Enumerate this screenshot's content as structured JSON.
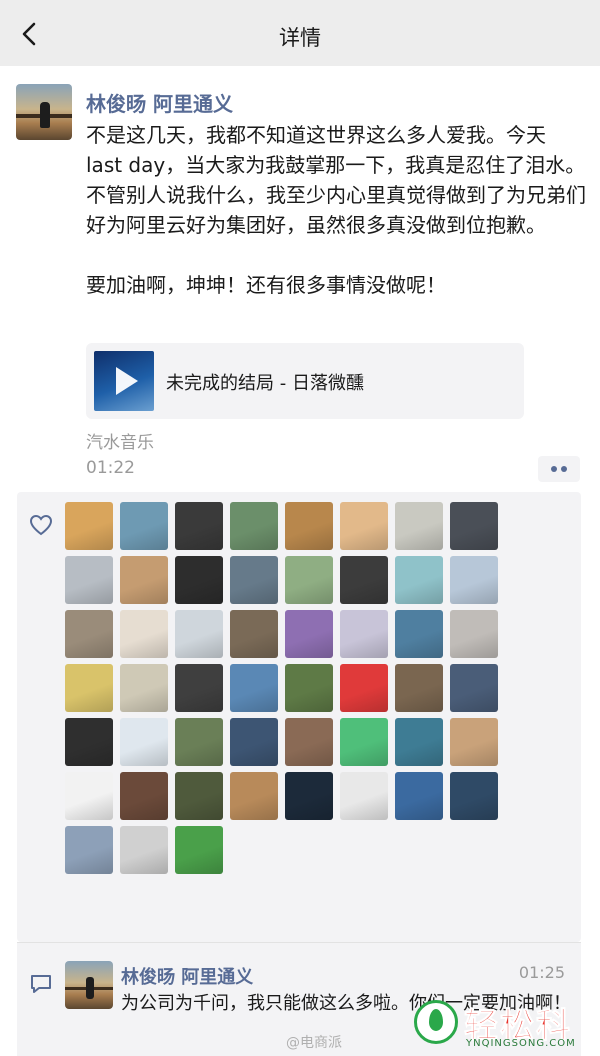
{
  "header": {
    "title": "详情"
  },
  "post": {
    "author": "林俊旸 阿里通义",
    "paragraph1": "不是这几天，我都不知道这世界这么多人爱我。今天 last day，当大家为我鼓掌那一下，我真是忍住了泪水。不管别人说我什么，我至少内心里真觉得做到了为兄弟们好为阿里云好为集团好，虽然很多真没做到位抱歉。",
    "paragraph2": "要加油啊，坤坤！还有很多事情没做呢！",
    "music": {
      "title": "未完成的结局 - 日落微醺"
    },
    "source": "汽水音乐",
    "time": "01:22"
  },
  "likes": {
    "count_visible": 51,
    "colors": [
      "#d9a55c",
      "#6e9ab3",
      "#3a3a3a",
      "#6b8f6a",
      "#b8874c",
      "#e2b98a",
      "#c9c9c1",
      "#4a4f57",
      "#b7bdc4",
      "#c59c71",
      "#2d2d2d",
      "#667a8a",
      "#8fae83",
      "#3c3c3c",
      "#8fc2c9",
      "#b7c7d8",
      "#9a8c7a",
      "#e6ddd1",
      "#cfd6dc",
      "#7a6a57",
      "#8e6fb2",
      "#c8c4d8",
      "#4f7fa0",
      "#c0bcb8",
      "#d9c36a",
      "#cfc9b6",
      "#3f3f3f",
      "#5a88b5",
      "#5e7a46",
      "#e03a3a",
      "#7a6650",
      "#4a5d78",
      "#2f2f2f",
      "#dfe7ee",
      "#6a7f57",
      "#3d5573",
      "#8a6a55",
      "#4fbf7a",
      "#3e7c94",
      "#c9a27a",
      "#f2f2f2",
      "#6b4a3a",
      "#4f5a3c",
      "#b88a5a",
      "#1c2a3a",
      "#e8e8e8",
      "#3b6aa0",
      "#2f4a66",
      "#8da0b8",
      "#d0d0d0",
      "#4aa04a",
      "#9ab0a0",
      "#d49a2a",
      "#d8cfc6",
      "#8a7a6a",
      "#b7cde0",
      "#a7b9c8",
      "#eaeaea",
      "#7a5aa0"
    ]
  },
  "comment": {
    "author": "林俊旸 阿里通义",
    "time": "01:25",
    "text": "为公司为千问，我只能做这么多啦。你们一定要加油啊！"
  },
  "watermarks": {
    "weibo": "@电商派",
    "logo_text": "轻松科技",
    "logo_sub": "YNQINGSONG.COM"
  }
}
